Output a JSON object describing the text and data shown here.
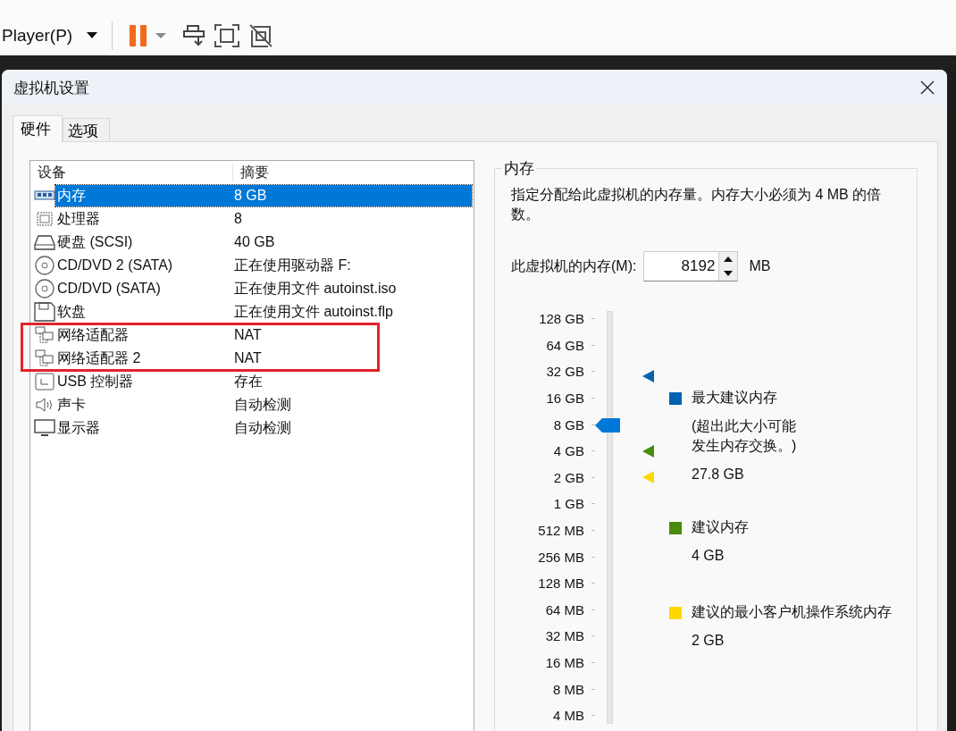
{
  "toolbar": {
    "menu": "Player(P)"
  },
  "dialog": {
    "title": "虚拟机设置",
    "tabs": [
      {
        "label": "硬件",
        "selected": true
      },
      {
        "label": "选项",
        "selected": false
      }
    ],
    "devices": {
      "columns": [
        "设备",
        "摘要"
      ],
      "rows": [
        {
          "kind": "memory",
          "name": "内存",
          "summary": "8 GB",
          "selected": true,
          "highlighted": false
        },
        {
          "kind": "cpu",
          "name": "处理器",
          "summary": "8",
          "selected": false,
          "highlighted": false
        },
        {
          "kind": "disk",
          "name": "硬盘 (SCSI)",
          "summary": "40 GB",
          "selected": false,
          "highlighted": false
        },
        {
          "kind": "cd",
          "name": "CD/DVD 2 (SATA)",
          "summary": "正在使用驱动器 F:",
          "selected": false,
          "highlighted": false
        },
        {
          "kind": "cd",
          "name": "CD/DVD (SATA)",
          "summary": "正在使用文件 autoinst.iso",
          "selected": false,
          "highlighted": false
        },
        {
          "kind": "floppy",
          "name": "软盘",
          "summary": "正在使用文件 autoinst.flp",
          "selected": false,
          "highlighted": false
        },
        {
          "kind": "network",
          "name": "网络适配器",
          "summary": "NAT",
          "selected": false,
          "highlighted": true
        },
        {
          "kind": "network",
          "name": "网络适配器 2",
          "summary": "NAT",
          "selected": false,
          "highlighted": true
        },
        {
          "kind": "usb",
          "name": "USB 控制器",
          "summary": "存在",
          "selected": false,
          "highlighted": false
        },
        {
          "kind": "sound",
          "name": "声卡",
          "summary": "自动检测",
          "selected": false,
          "highlighted": false
        },
        {
          "kind": "display",
          "name": "显示器",
          "summary": "自动检测",
          "selected": false,
          "highlighted": false
        }
      ]
    },
    "memory": {
      "group_title": "内存",
      "description": "指定分配给此虚拟机的内存量。内存大小必须为 4 MB 的倍数。",
      "field_label": "此虚拟机的内存(M):",
      "value": "8192",
      "unit": "MB",
      "slider": {
        "level": 0.733,
        "ticks": [
          "128 GB",
          "64 GB",
          "32 GB",
          "16 GB",
          "8 GB",
          "4 GB",
          "2 GB",
          "1 GB",
          "512 MB",
          "256 MB",
          "128 MB",
          "64 MB",
          "32 MB",
          "16 MB",
          "8 MB",
          "4 MB"
        ]
      },
      "legend": [
        {
          "label": "最大建议内存",
          "note": "(超出此大小可能发生内存交换。)",
          "value": "27.8 GB",
          "color": "#0063b1"
        },
        {
          "label": "建议内存",
          "value": "4 GB",
          "color": "#498b0d"
        },
        {
          "label": "建议的最小客户机操作系统内存",
          "value": "2 GB",
          "color": "#ffd800"
        }
      ]
    }
  }
}
